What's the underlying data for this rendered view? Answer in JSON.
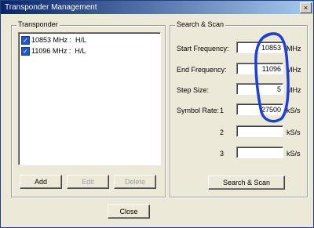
{
  "window": {
    "title": "Transponder Management",
    "close_glyph": "×",
    "close_label": "Close"
  },
  "transponder": {
    "legend": "Transponder",
    "items": [
      {
        "text": "10853 MHz :  H/L",
        "checked": true
      },
      {
        "text": "11096 MHz :  H/L",
        "checked": true
      }
    ],
    "add_label": "Add",
    "edit_label": "Edit",
    "delete_label": "Delete"
  },
  "search": {
    "legend": "Search & Scan",
    "start_freq_label": "Start Frequency:",
    "start_freq_value": "10853",
    "start_freq_unit": "MHz",
    "end_freq_label": "End Frequency:",
    "end_freq_value": "11096",
    "end_freq_unit": "MHz",
    "step_label": "Step Size:",
    "step_value": "5",
    "step_unit": "MHz",
    "symbol_label": "Symbol Rate:",
    "symbol_rows": [
      {
        "index": "1",
        "value": "27500",
        "unit": "kS/s"
      },
      {
        "index": "2",
        "value": "",
        "unit": "kS/s"
      },
      {
        "index": "3",
        "value": "",
        "unit": "kS/s"
      }
    ],
    "scan_button_label": "Search & Scan"
  },
  "annotation": {
    "color": "#1f3fd8",
    "icon": "hand-drawn-circle"
  }
}
